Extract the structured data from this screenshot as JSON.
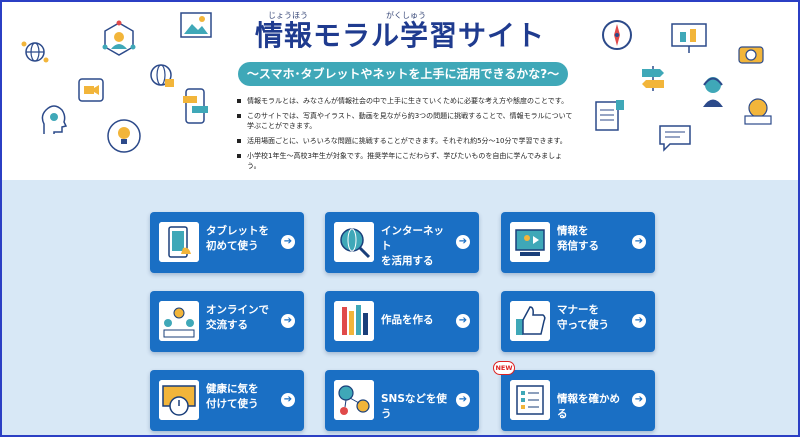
{
  "header": {
    "title": "情報モラル学習サイト",
    "title_ruby_1": "じょうほう",
    "title_ruby_2": "がくしゅう",
    "subtitle": "～スマホ･タブレットやネットを上手に活用できるかな?～"
  },
  "intro": {
    "bullets": [
      "情報モラルとは、みなさんが情報社会の中で上手に生きていくために必要な考え方や態度のことです。",
      "このサイトでは、写真やイラスト、動画を見ながら約3つの問題に挑戦することで、情報モラルについて学ぶことができます。",
      "活用場面ごとに、いろいろな問題に挑戦することができます。それぞれ約5分～10分で学習できます。",
      "小学校1年生～高校3年生が対象です。推奨学年にこだわらず、学びたいものを自由に学んでみましょう。"
    ]
  },
  "cards": [
    {
      "label": "タブレットを\n初めて使う",
      "icon": "tablet-icon"
    },
    {
      "label": "インターネット\nを活用する",
      "icon": "globe-magnifier-icon"
    },
    {
      "label": "情報を\n発信する",
      "icon": "video-post-icon"
    },
    {
      "label": "オンラインで\n交流する",
      "icon": "online-meeting-icon"
    },
    {
      "label": "作品を作る",
      "icon": "pencils-icon"
    },
    {
      "label": "マナーを\n守って使う",
      "icon": "thumbs-up-icon"
    },
    {
      "label": "健康に気を\n付けて使う",
      "icon": "monitor-timer-icon"
    },
    {
      "label": "SNSなどを使う",
      "icon": "sns-network-icon"
    },
    {
      "label": "情報を確かめる",
      "icon": "check-document-icon"
    }
  ],
  "new_badge": "NEW",
  "arrow_glyph": "➔",
  "colors": {
    "title": "#1f3b8f",
    "subtitle_bg": "#3fa8b8",
    "card_bg": "#1a6fc4",
    "grid_bg": "#d8e8f6",
    "frame": "#2b3fc4",
    "badge": "#dd2222"
  }
}
